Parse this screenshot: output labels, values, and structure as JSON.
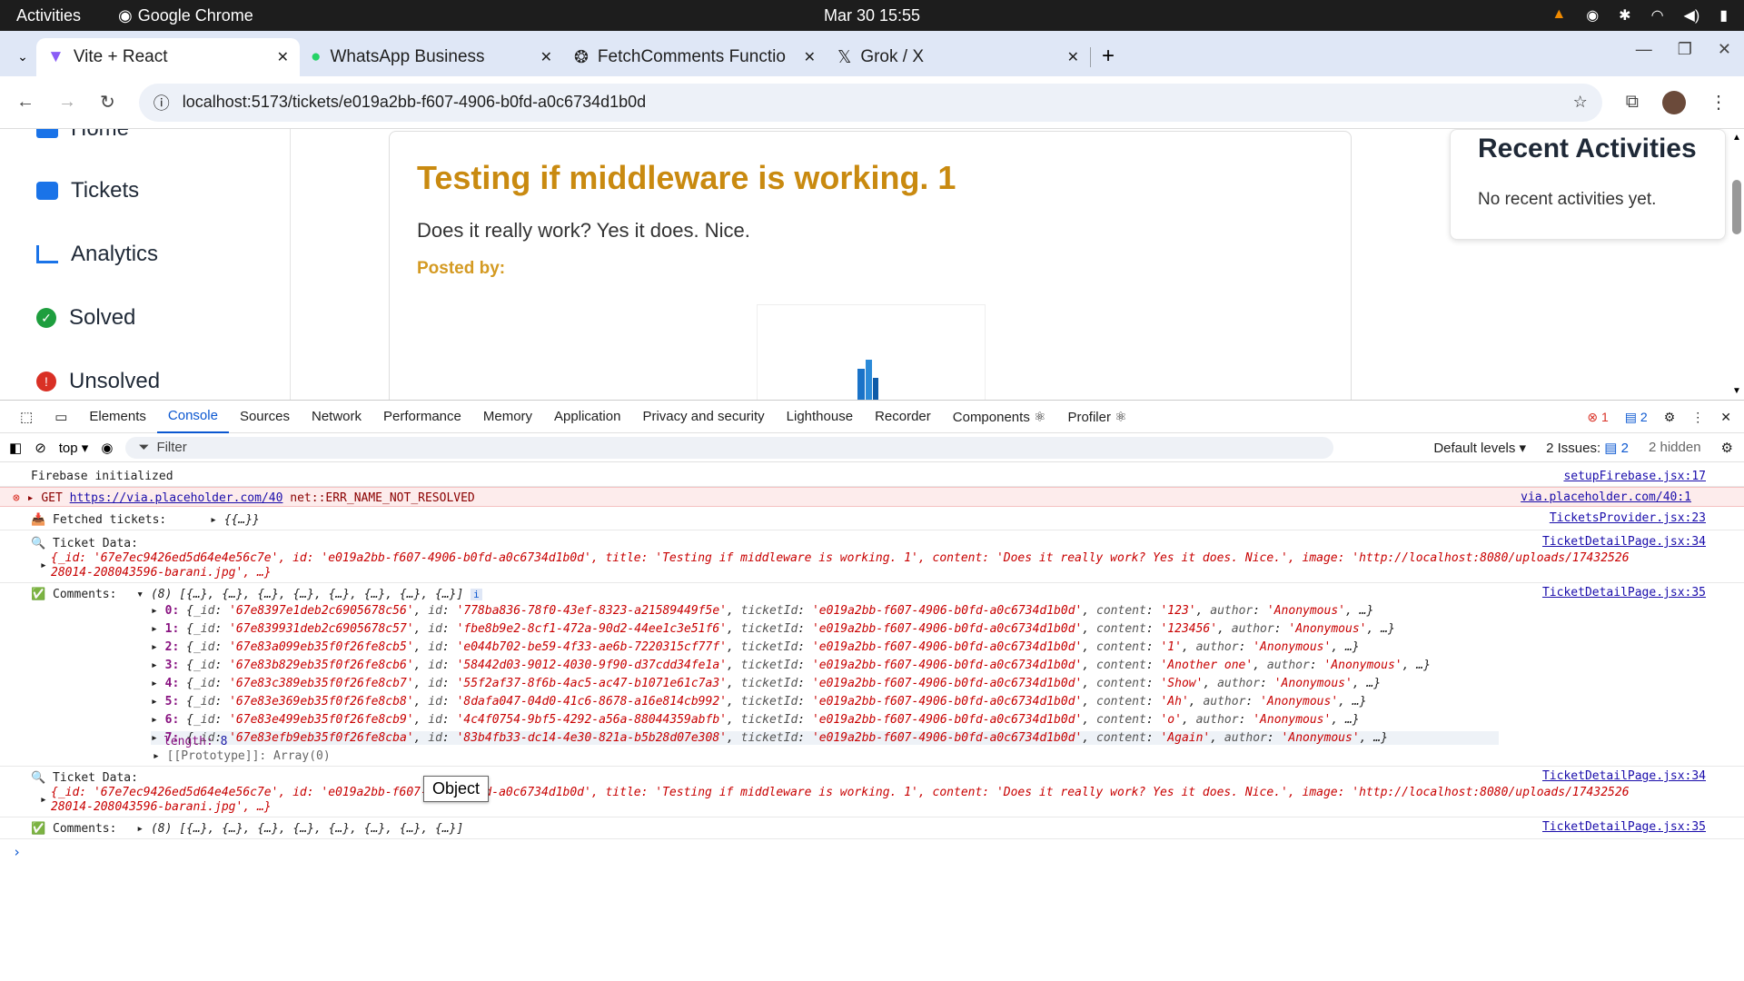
{
  "topbar": {
    "activities": "Activities",
    "app": "Google Chrome",
    "clock": "Mar 30  15:55"
  },
  "tabs": [
    {
      "title": "Vite + React",
      "active": true
    },
    {
      "title": "WhatsApp Business",
      "active": false
    },
    {
      "title": "FetchComments Functio",
      "active": false
    },
    {
      "title": "Grok / X",
      "active": false
    }
  ],
  "address": {
    "url": "localhost:5173/tickets/e019a2bb-f607-4906-b0fd-a0c6734d1b0d"
  },
  "sidebar": {
    "items": [
      {
        "label": "Home",
        "color": "#1a73e8"
      },
      {
        "label": "Tickets",
        "color": "#1a73e8"
      },
      {
        "label": "Analytics",
        "color": "#1a73e8"
      },
      {
        "label": "Solved",
        "color": "#1e9e3e"
      },
      {
        "label": "Unsolved",
        "color": "#d93025"
      }
    ]
  },
  "ticket": {
    "title": "Testing if middleware is working. 1",
    "content": "Does it really work? Yes it does. Nice.",
    "posted_by": "Posted by:"
  },
  "recent": {
    "title": "Recent Activities",
    "empty": "No recent activities yet."
  },
  "devtools": {
    "tabs": [
      "Elements",
      "Console",
      "Sources",
      "Network",
      "Performance",
      "Memory",
      "Application",
      "Privacy and security",
      "Lighthouse",
      "Recorder",
      "Components ⚛",
      "Profiler ⚛"
    ],
    "errors": "1",
    "messages": "2",
    "context": "top",
    "filter_placeholder": "Filter",
    "levels": "Default levels",
    "issues_label": "2 Issues:",
    "issues_count": "2",
    "hidden": "2 hidden"
  },
  "console": {
    "firebase": "Firebase initialized",
    "firebase_src": "setupFirebase.jsx:17",
    "get_prefix": "GET",
    "get_url": "https://via.placeholder.com/40",
    "get_error": "net::ERR_NAME_NOT_RESOLVED",
    "get_src": "via.placeholder.com/40:1",
    "fetched": "📥 Fetched tickets:",
    "fetched_val": "{{…}}",
    "fetched_src": "TicketsProvider.jsx:23",
    "ticket_label": "🔍 Ticket Data:",
    "ticket_src": "TicketDetailPage.jsx:34",
    "ticket_line1": "{_id: '67e7ec9426ed5d64e4e56c7e', id: 'e019a2bb-f607-4906-b0fd-a0c6734d1b0d', title: 'Testing if middleware is working. 1', content: 'Does it really work? Yes it does. Nice.', image: 'http://localhost:8080/uploads/17432526",
    "ticket_line2": "28014-208043596-barani.jpg', …}",
    "comments_label": "✅ Comments:",
    "comments_src": "TicketDetailPage.jsx:35",
    "comments_summary": "(8) [{…}, {…}, {…}, {…}, {…}, {…}, {…}, {…}]",
    "comments": [
      {
        "i": "0",
        "_id": "'67e8397e1deb2c6905678c56'",
        "id": "'778ba836-78f0-43ef-8323-a21589449f5e'",
        "tid": "'e019a2bb-f607-4906-b0fd-a0c6734d1b0d'",
        "content": "'123'",
        "author": "'Anonymous'"
      },
      {
        "i": "1",
        "_id": "'67e839931deb2c6905678c57'",
        "id": "'fbe8b9e2-8cf1-472a-90d2-44ee1c3e51f6'",
        "tid": "'e019a2bb-f607-4906-b0fd-a0c6734d1b0d'",
        "content": "'123456'",
        "author": "'Anonymous'"
      },
      {
        "i": "2",
        "_id": "'67e83a099eb35f0f26fe8cb5'",
        "id": "'e044b702-be59-4f33-ae6b-7220315cf77f'",
        "tid": "'e019a2bb-f607-4906-b0fd-a0c6734d1b0d'",
        "content": "'1'",
        "author": "'Anonymous'"
      },
      {
        "i": "3",
        "_id": "'67e83b829eb35f0f26fe8cb6'",
        "id": "'58442d03-9012-4030-9f90-d37cdd34fe1a'",
        "tid": "'e019a2bb-f607-4906-b0fd-a0c6734d1b0d'",
        "content": "'Another one'",
        "author": "'Anonymous'"
      },
      {
        "i": "4",
        "_id": "'67e83c389eb35f0f26fe8cb7'",
        "id": "'55f2af37-8f6b-4ac5-ac47-b1071e61c7a3'",
        "tid": "'e019a2bb-f607-4906-b0fd-a0c6734d1b0d'",
        "content": "'Show'",
        "author": "'Anonymous'"
      },
      {
        "i": "5",
        "_id": "'67e83e369eb35f0f26fe8cb8'",
        "id": "'8dafa047-04d0-41c6-8678-a16e814cb992'",
        "tid": "'e019a2bb-f607-4906-b0fd-a0c6734d1b0d'",
        "content": "'Ah'",
        "author": "'Anonymous'"
      },
      {
        "i": "6",
        "_id": "'67e83e499eb35f0f26fe8cb9'",
        "id": "'4c4f0754-9bf5-4292-a56a-88044359abfb'",
        "tid": "'e019a2bb-f607-4906-b0fd-a0c6734d1b0d'",
        "content": "'o'",
        "author": "'Anonymous'"
      },
      {
        "i": "7",
        "_id": "'67e83efb9eb35f0f26fe8cba'",
        "id": "'83b4fb33-dc14-4e30-821a-b5b28d07e308'",
        "tid": "'e019a2bb-f607-4906-b0fd-a0c6734d1b0d'",
        "content": "'Again'",
        "author": "'Anonymous'"
      }
    ],
    "length_label": "length:",
    "length_value": "8",
    "prototype": "[[Prototype]]: Array(0)",
    "tooltip": "Object",
    "comments_collapsed": "(8) [{…}, {…}, {…}, {…}, {…}, {…}, {…}, {…}]"
  }
}
